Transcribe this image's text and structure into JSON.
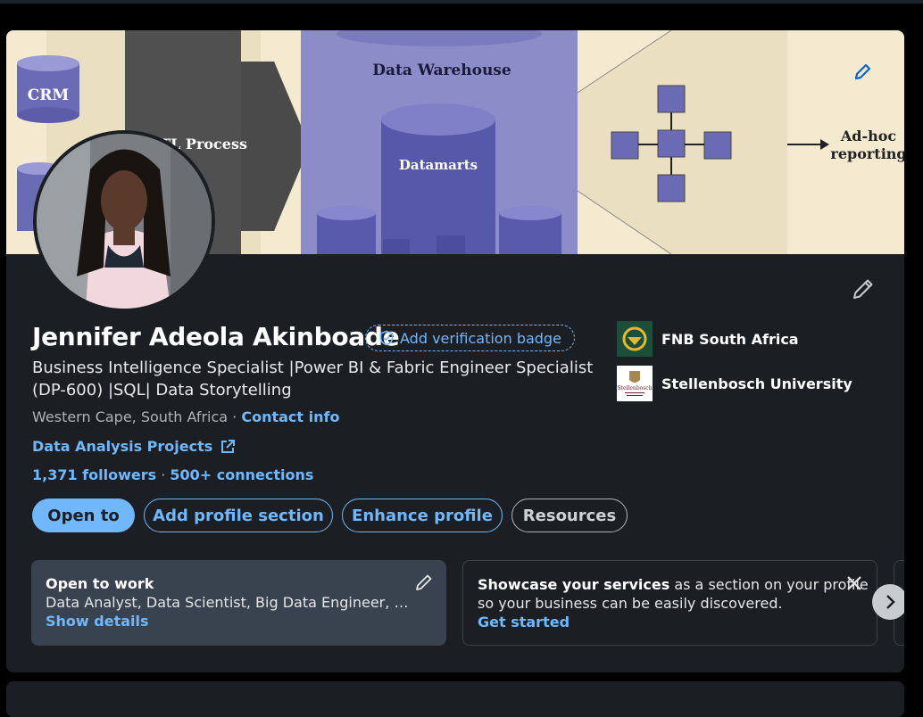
{
  "banner": {
    "labels": {
      "crm": "CRM",
      "etl": "ETL Process",
      "warehouse": "Data Warehouse",
      "datamarts": "Datamarts",
      "adhoc_line1": "Ad-hoc",
      "adhoc_line2": "reporting"
    }
  },
  "profile": {
    "name": "Jennifer Adeola Akinboade",
    "verification_badge": "Add verification badge",
    "headline": "Business Intelligence Specialist |Power BI & Fabric Engineer Specialist (DP-600) |SQL| Data Storytelling",
    "location": "Western Cape, South Africa",
    "location_sep": " · ",
    "contact_info": "Contact info",
    "website": "Data Analysis Projects",
    "followers": "1,371 followers",
    "connections_sep": " · ",
    "connections": "500+ connections"
  },
  "organizations": [
    {
      "name": "FNB South Africa",
      "icon": "fnb-logo"
    },
    {
      "name": "Stellenbosch University",
      "icon": "stellenbosch-logo",
      "logo_text": "Stellenbosch"
    }
  ],
  "actions": {
    "open_to": "Open to",
    "add_section": "Add profile section",
    "enhance": "Enhance profile",
    "resources": "Resources"
  },
  "open_to_work": {
    "title": "Open to work",
    "roles": "Data Analyst, Data Scientist, Big Data Engineer, Bu...",
    "link": "Show details"
  },
  "services": {
    "bold": "Showcase your services",
    "text": " as a section on your profile",
    "text2": "so your business can be easily discovered.",
    "link": "Get started"
  },
  "colors": {
    "accent": "#71b7fb",
    "card_bg": "#1b1f23",
    "panel_bg": "#38434f"
  }
}
